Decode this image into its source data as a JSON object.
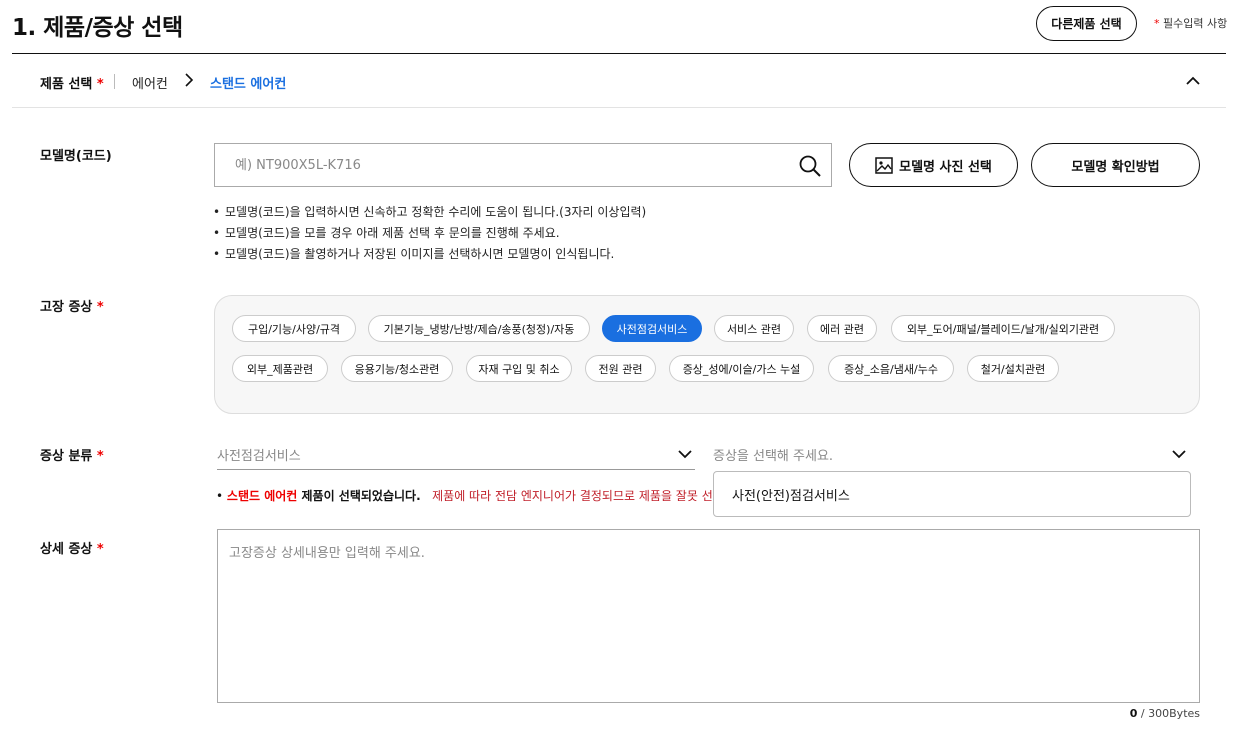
{
  "header": {
    "title": "1. 제품/증상 선택",
    "other_product_button": "다른제품 선택",
    "required_note_star": "*",
    "required_note": " 필수입력 사항"
  },
  "product_selection": {
    "label": "제품 선택",
    "star": "*",
    "category": "에어컨",
    "subcategory": "스탠드 에어컨",
    "collapse_icon": "chevron-up-icon"
  },
  "model": {
    "label": "모델명(코드)",
    "placeholder": "예) NT900X5L-K716",
    "value": "",
    "search_icon": "search-icon",
    "photo_button": "모델명 사진 선택",
    "howto_button": "모델명 확인방법",
    "notes": [
      "모델명(코드)을 입력하시면 신속하고 정확한 수리에 도움이 됩니다.(3자리 이상입력)",
      "모델명(코드)을 모를 경우 아래 제품 선택 후 문의를 진행해 주세요.",
      "모델명(코드)을 촬영하거나 저장된 이미지를 선택하시면 모델명이 인식됩니다."
    ]
  },
  "symptom": {
    "label": "고장 증상",
    "star": "*",
    "chips": [
      {
        "label": "구입/기능/사양/규격",
        "active": false
      },
      {
        "label": "기본기능_냉방/난방/제습/송풍(청정)/자동",
        "active": false
      },
      {
        "label": "사전점검서비스",
        "active": true
      },
      {
        "label": "서비스 관련",
        "active": false
      },
      {
        "label": "에러 관련",
        "active": false
      },
      {
        "label": "외부_도어/패널/블레이드/날개/실외기관련",
        "active": false
      },
      {
        "label": "외부_제품관련",
        "active": false
      },
      {
        "label": "응용기능/청소관련",
        "active": false
      },
      {
        "label": "자재 구입 및 취소",
        "active": false
      },
      {
        "label": "전원 관련",
        "active": false
      },
      {
        "label": "증상_성에/이슬/가스 누설",
        "active": false
      },
      {
        "label": "증상_소음/냄새/누수",
        "active": false
      },
      {
        "label": "철거/설치관련",
        "active": false
      }
    ]
  },
  "classification": {
    "label": "증상 분류",
    "star": "*",
    "select1_value": "사전점검서비스",
    "select2_placeholder": "증상을 선택해 주세요.",
    "dropdown_option": "사전(안전)점검서비스",
    "info_product": "스탠드 에어컨",
    "info_selected": " 제품이 선택되었습니다.",
    "info_warning": "제품에 따라 전담 엔지니어가 결정되므로 제품을 잘못 선"
  },
  "detail": {
    "label": "상세 증상",
    "star": "*",
    "placeholder": "고장증상 상세내용만 입력해 주세요.",
    "value": "",
    "count": "0",
    "limit": " / 300Bytes"
  },
  "colors": {
    "accent": "#1a6fe0",
    "required": "#e00000",
    "warning": "#c0202a"
  }
}
